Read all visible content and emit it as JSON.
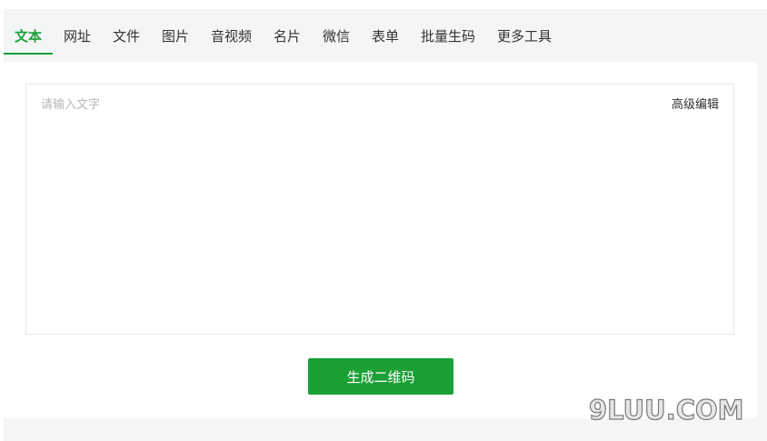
{
  "tabs": [
    {
      "label": "文本",
      "active": true
    },
    {
      "label": "网址",
      "active": false
    },
    {
      "label": "文件",
      "active": false
    },
    {
      "label": "图片",
      "active": false
    },
    {
      "label": "音视频",
      "active": false
    },
    {
      "label": "名片",
      "active": false
    },
    {
      "label": "微信",
      "active": false
    },
    {
      "label": "表单",
      "active": false
    },
    {
      "label": "批量生码",
      "active": false
    },
    {
      "label": "更多工具",
      "active": false
    }
  ],
  "editor": {
    "placeholder": "请输入文字",
    "value": "",
    "advanced_edit_label": "高级编辑"
  },
  "generate_button_label": "生成二维码",
  "watermark": "9LUU.COM",
  "colors": {
    "accent": "#1ba035",
    "background": "#f4f5f7"
  }
}
